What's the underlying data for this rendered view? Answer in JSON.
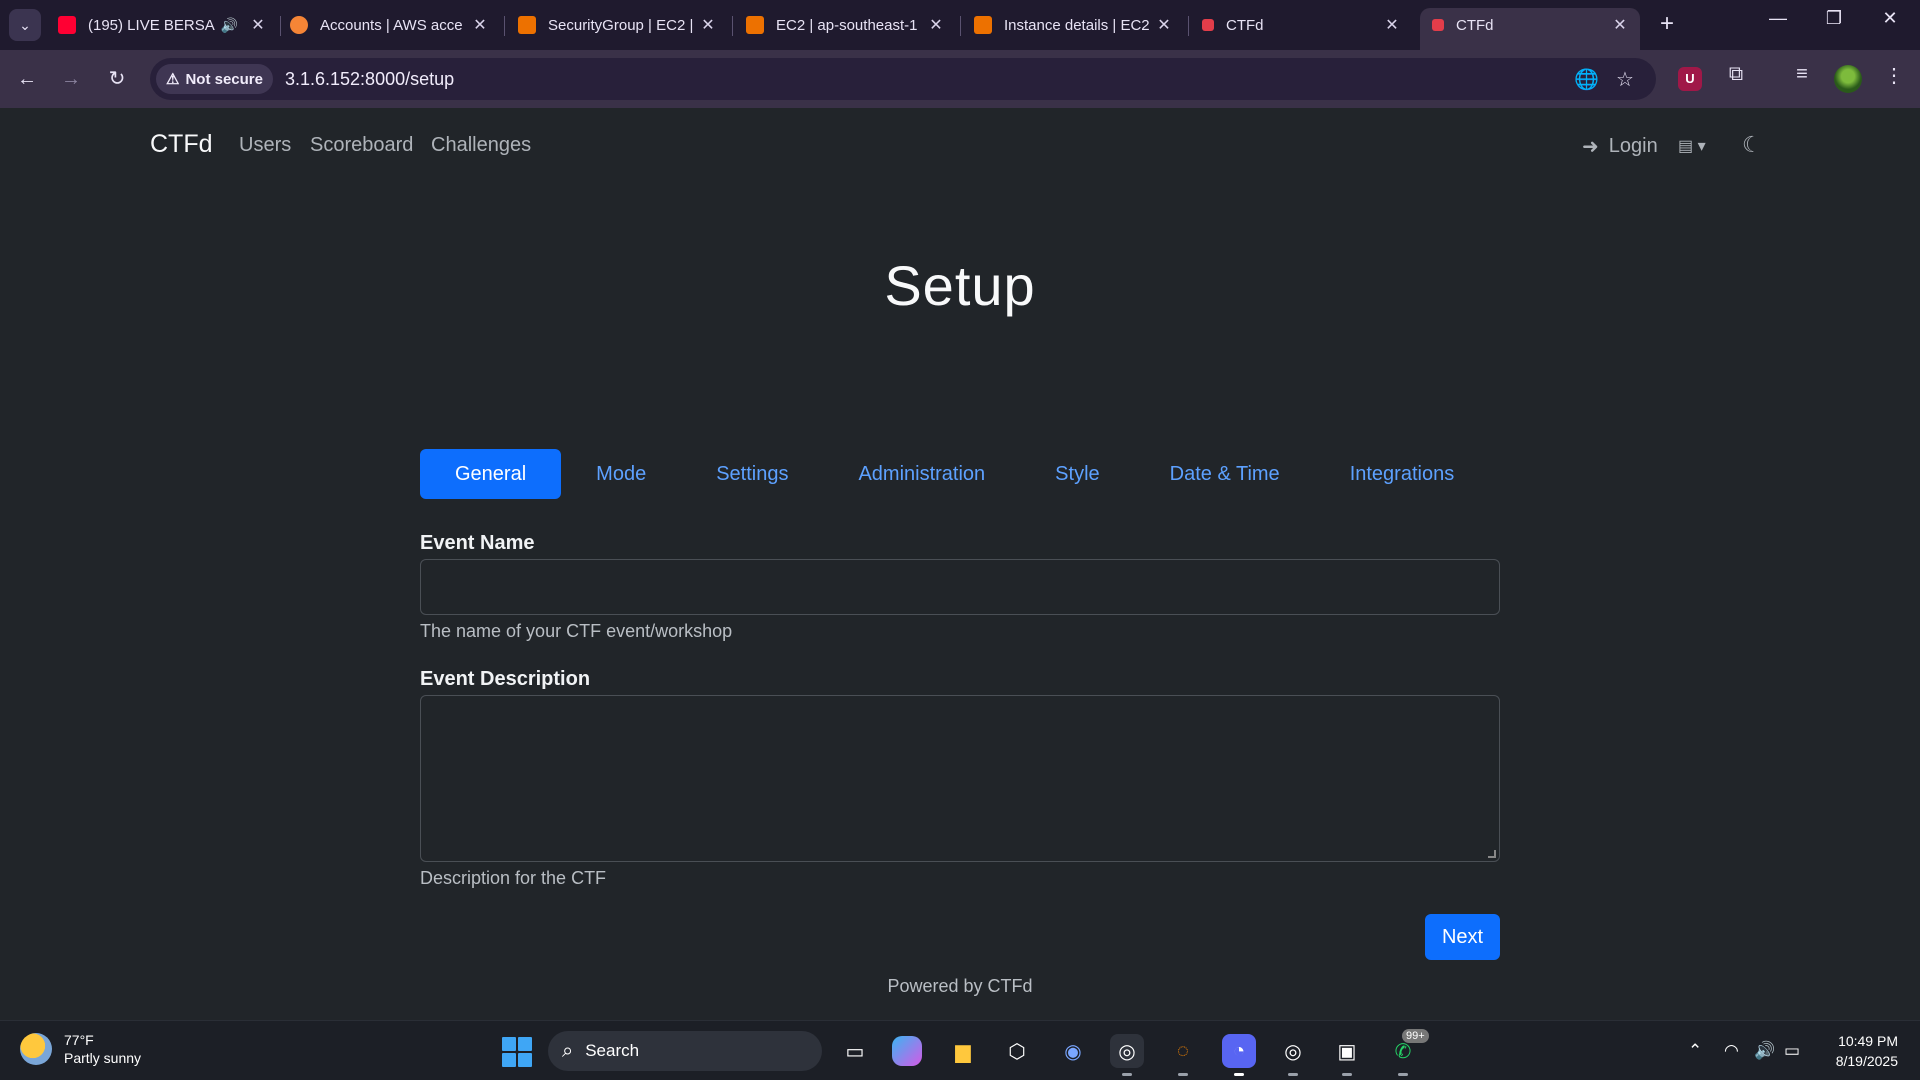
{
  "browser": {
    "tabs": [
      {
        "title": "(195) LIVE BERSA",
        "icon": "youtube-icon",
        "color": "#ff0033",
        "audio": true
      },
      {
        "title": "Accounts | AWS acce",
        "icon": "aws-icon",
        "color": "#f58536"
      },
      {
        "title": "SecurityGroup | EC2 |",
        "icon": "ec2-icon",
        "color": "#ed7100"
      },
      {
        "title": "EC2 | ap-southeast-1",
        "icon": "ec2-icon",
        "color": "#ed7100"
      },
      {
        "title": "Instance details | EC2",
        "icon": "ec2-icon",
        "color": "#ed7100"
      },
      {
        "title": "CTFd",
        "icon": "ctfd-icon",
        "color": "#e23d4a"
      },
      {
        "title": "CTFd",
        "icon": "ctfd-icon",
        "color": "#e23d4a",
        "active": true
      }
    ],
    "security_chip": "Not secure",
    "url": "3.1.6.152:8000/setup"
  },
  "navbar": {
    "brand": "CTFd",
    "links": [
      "Users",
      "Scoreboard",
      "Challenges"
    ],
    "login": "Login"
  },
  "setup": {
    "title": "Setup",
    "tabs": [
      "General",
      "Mode",
      "Settings",
      "Administration",
      "Style",
      "Date & Time",
      "Integrations"
    ],
    "active_tab": "General",
    "event_name_label": "Event Name",
    "event_name_value": "",
    "event_name_help": "The name of your CTF event/workshop",
    "event_description_label": "Event Description",
    "event_description_value": "",
    "event_description_help": "Description for the CTF",
    "next_button": "Next"
  },
  "footer": {
    "text": "Powered by CTFd"
  },
  "taskbar": {
    "weather_temp": "77°F",
    "weather_desc": "Partly sunny",
    "search_label": "Search",
    "notification_badge": "99+",
    "time": "10:49 PM",
    "date": "8/19/2025"
  },
  "colors": {
    "accent": "#0d6efd",
    "link": "#5da1ff",
    "page_bg": "#212529"
  }
}
